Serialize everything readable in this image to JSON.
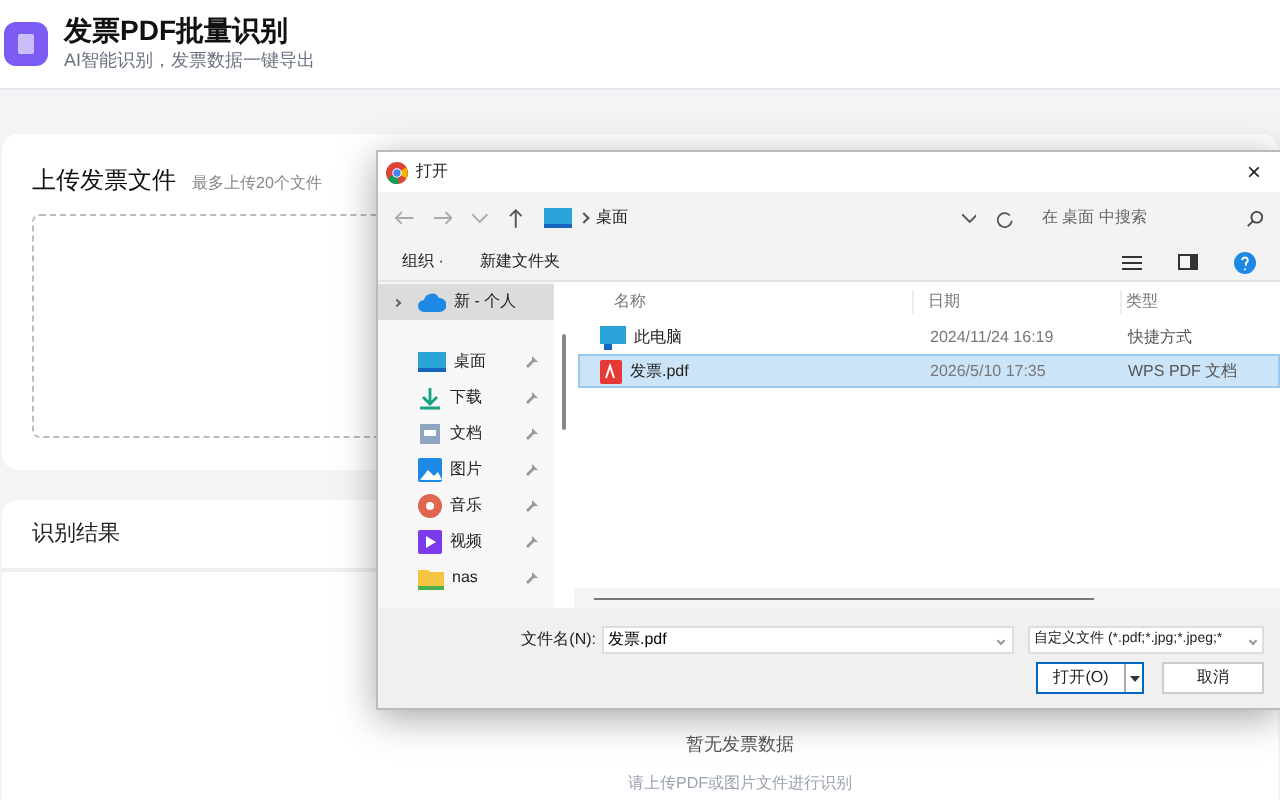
{
  "app": {
    "title": "发票PDF批量识别",
    "subtitle": "AI智能识别，发票数据一键导出"
  },
  "upload": {
    "title": "上传发票文件",
    "hint": "最多上传20个文件"
  },
  "results": {
    "title": "识别结果",
    "empty_title": "暂无发票数据",
    "empty_hint": "请上传PDF或图片文件进行识别"
  },
  "dialog": {
    "title": "打开",
    "close": "×",
    "path": "桌面",
    "search_placeholder": "在 桌面 中搜索",
    "toolbar": [
      "组织 ·",
      "新建文件夹"
    ],
    "sidebar": [
      {
        "label": "新 - 个人",
        "kind": "cloud",
        "selected": true,
        "pinned": false
      },
      {
        "label": "桌面",
        "kind": "desktop",
        "selected": false,
        "pinned": true
      },
      {
        "label": "下载",
        "kind": "download",
        "selected": false,
        "pinned": true
      },
      {
        "label": "文档",
        "kind": "document",
        "selected": false,
        "pinned": true
      },
      {
        "label": "图片",
        "kind": "pictures",
        "selected": false,
        "pinned": true
      },
      {
        "label": "音乐",
        "kind": "music",
        "selected": false,
        "pinned": true
      },
      {
        "label": "视频",
        "kind": "video",
        "selected": false,
        "pinned": true
      },
      {
        "label": "nas",
        "kind": "folder",
        "selected": false,
        "pinned": true
      }
    ],
    "columns": [
      "名称",
      "日期",
      "类型"
    ],
    "files": [
      {
        "name": "此电脑",
        "date": "2024/11/24 16:19",
        "type": "快捷方式",
        "kind": "computer",
        "selected": false
      },
      {
        "name": "发票.pdf",
        "date": "2026/5/10 17:35",
        "type": "WPS PDF 文档",
        "kind": "pdf",
        "selected": true
      }
    ],
    "filename_label": "文件名(N):",
    "filename": "发票.pdf",
    "filter": "自定义文件 (*.pdf;*.jpg;*.jpeg;*",
    "open": "打开(O)",
    "cancel": "取消"
  }
}
